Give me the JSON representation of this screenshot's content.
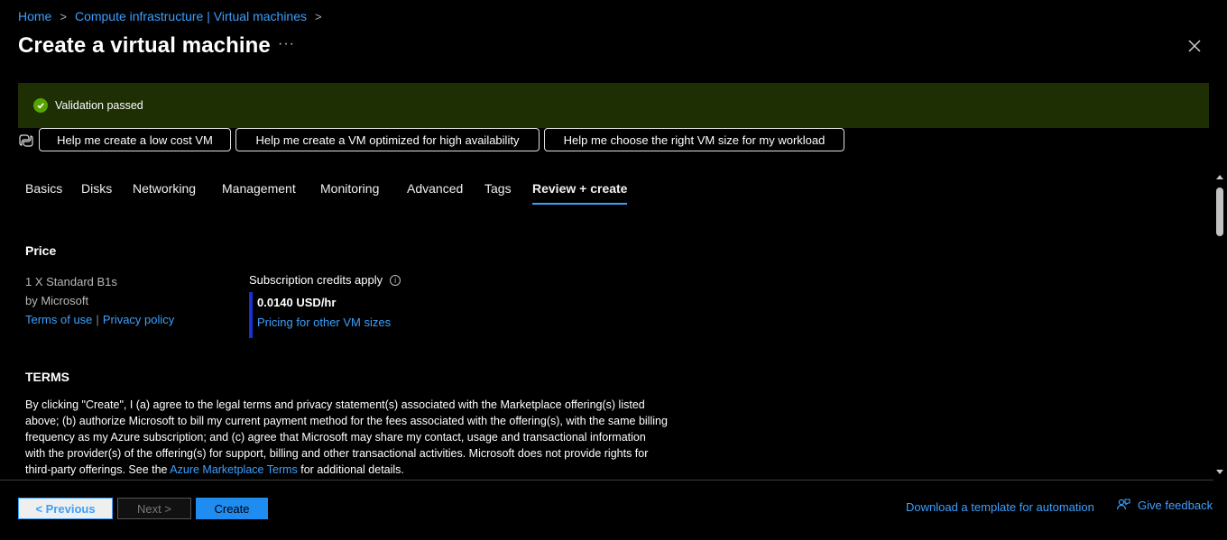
{
  "breadcrumb": {
    "items": [
      "Home",
      "Compute infrastructure | Virtual machines"
    ],
    "separator": ">"
  },
  "page": {
    "title": "Create a virtual machine",
    "more": "···"
  },
  "validation": {
    "text": "Validation passed",
    "color": "#57a300"
  },
  "copilot": {
    "prompts": [
      "Help me create a low cost VM",
      "Help me create a VM optimized for high availability",
      "Help me choose the right VM size for my workload"
    ]
  },
  "tabs": [
    {
      "label": "Basics"
    },
    {
      "label": "Disks"
    },
    {
      "label": "Networking"
    },
    {
      "label": "Management"
    },
    {
      "label": "Monitoring"
    },
    {
      "label": "Advanced"
    },
    {
      "label": "Tags"
    },
    {
      "label": "Review + create",
      "active": true
    }
  ],
  "price": {
    "heading": "Price",
    "product": "1 X Standard B1s",
    "publisher": "by Microsoft",
    "terms_link": "Terms of use",
    "pipe": "|",
    "privacy_link": "Privacy policy",
    "credits_label": "Subscription credits apply",
    "info_glyph": "i",
    "rate": "0.0140 USD/hr",
    "other_sizes_link": "Pricing for other VM sizes"
  },
  "terms": {
    "heading": "TERMS",
    "body_before": "By clicking \"Create\", I (a) agree to the legal terms and privacy statement(s) associated with the Marketplace offering(s) listed above; (b) authorize Microsoft to bill my current payment method for the fees associated with the offering(s), with the same billing frequency as my Azure subscription; and (c) agree that Microsoft may share my contact, usage and transactional information with the provider(s) of the offering(s) for support, billing and other transactional activities. Microsoft does not provide rights for third-party offerings. See the ",
    "link": "Azure Marketplace Terms",
    "body_after": " for additional details."
  },
  "footer": {
    "previous": "< Previous",
    "next": "Next >",
    "create": "Create",
    "download": "Download a template for automation",
    "feedback": "Give feedback"
  },
  "colors": {
    "accent": "#3ba0ff",
    "validation_bg": "#1d2f03",
    "price_bar": "#1a2fd6",
    "create_button": "#1f8cf0"
  }
}
